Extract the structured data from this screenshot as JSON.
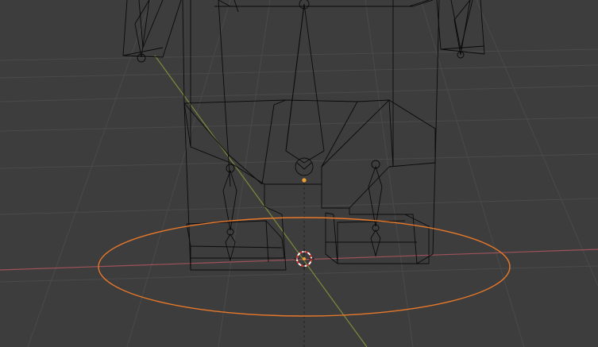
{
  "viewport": {
    "view": "3D Viewport",
    "shading": "wireframe",
    "objects": [
      "armature-rig",
      "character-mesh",
      "circle-control"
    ],
    "axes": [
      "x-axis",
      "y-axis",
      "z-axis"
    ],
    "colors": {
      "background": "#3d3d3d",
      "grid": "#4a4a4a",
      "wireframe": "#0a0a0a",
      "x_axis": "#a0525a",
      "y_axis": "#7a8d3a",
      "selected_outline": "#e8782a",
      "origin_dot": "#f0a030",
      "cursor_red": "#d8332f",
      "cursor_white": "#ffffff"
    }
  }
}
